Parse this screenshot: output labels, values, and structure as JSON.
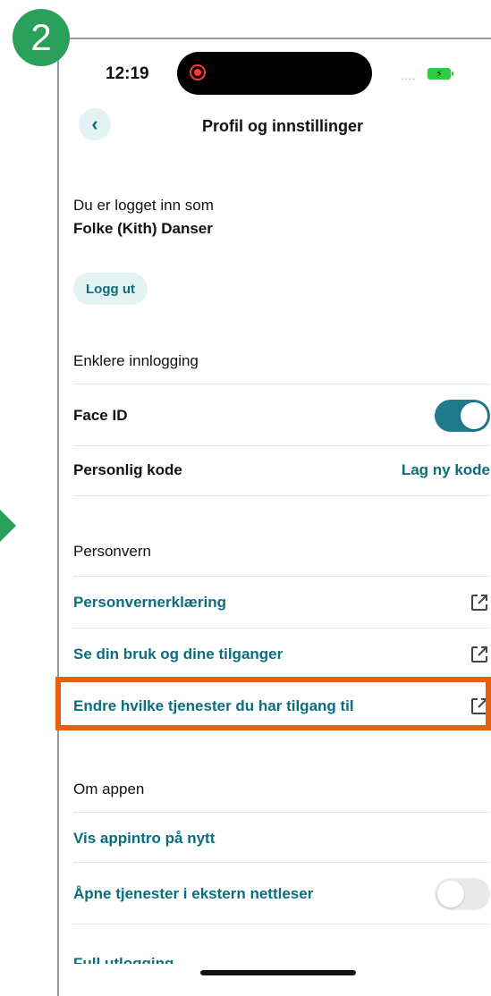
{
  "badge": {
    "step": "2"
  },
  "status_bar": {
    "time": "12:19",
    "signal": "....",
    "battery_icon": "battery-charging-icon"
  },
  "nav": {
    "back_icon": "chevron-left-icon",
    "title": "Profil og innstillinger"
  },
  "account": {
    "label": "Du er logget inn som",
    "name": "Folke (Kith) Danser",
    "logout_label": "Logg ut"
  },
  "login": {
    "header": "Enklere innlogging",
    "face_id_label": "Face ID",
    "face_id_enabled": true,
    "code_label": "Personlig kode",
    "code_action": "Lag ny kode"
  },
  "privacy": {
    "header": "Personvern",
    "items": [
      {
        "label": "Personvernerklæring",
        "icon": "external-link-icon"
      },
      {
        "label": "Se din bruk og dine tilganger",
        "icon": "external-link-icon"
      },
      {
        "label": "Endre hvilke tjenester du har tilgang til",
        "icon": "external-link-icon"
      }
    ]
  },
  "about": {
    "header": "Om appen",
    "intro_label": "Vis appintro på nytt",
    "external_browser_label": "Åpne tjenester i ekstern nettleser",
    "external_browser_enabled": false,
    "full_logout_label": "Full utlogging"
  },
  "colors": {
    "accent": "#0b6d7d",
    "toggle_on": "#1f7a8a",
    "badge": "#2aa05a",
    "highlight": "#e8600f"
  }
}
